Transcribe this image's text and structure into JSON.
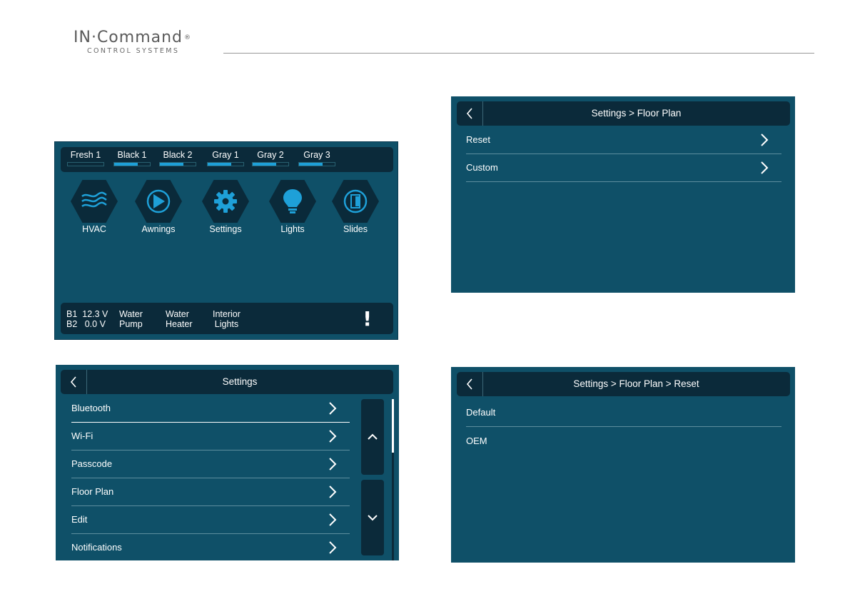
{
  "brand": {
    "name": "IN·Command",
    "registered": "®",
    "subtitle": "CONTROL SYSTEMS"
  },
  "colors": {
    "screen_bg": "#0f5068",
    "bar_bg": "#0b2a3a",
    "accent": "#1ea0d8",
    "page_bg": "#ffffff"
  },
  "home": {
    "tanks": [
      {
        "label": "Fresh 1",
        "level": 0
      },
      {
        "label": "Black 1",
        "level": 0.65
      },
      {
        "label": "Black 2",
        "level": 0.65
      },
      {
        "label": "Gray 1",
        "level": 0.65
      },
      {
        "label": "Gray 2",
        "level": 0.65
      },
      {
        "label": "Gray 3",
        "level": 0.65
      }
    ],
    "apps": [
      {
        "label": "HVAC",
        "icon": "hvac-waves-icon"
      },
      {
        "label": "Awnings",
        "icon": "awning-icon"
      },
      {
        "label": "Settings",
        "icon": "gear-icon"
      },
      {
        "label": "Lights",
        "icon": "lightbulb-icon"
      },
      {
        "label": "Slides",
        "icon": "slide-icon"
      }
    ],
    "battery": {
      "b1_label": "B1",
      "b1_value": "12.3 V",
      "b2_label": "B2",
      "b2_value": "0.0 V"
    },
    "toggles": [
      {
        "line1": "Water",
        "line2": "Pump"
      },
      {
        "line1": "Water",
        "line2": "Heater"
      },
      {
        "line1": "Interior",
        "line2": "Lights"
      }
    ],
    "alert": "!"
  },
  "settings": {
    "title": "Settings",
    "items": [
      {
        "label": "Bluetooth"
      },
      {
        "label": "Wi-Fi"
      },
      {
        "label": "Passcode"
      },
      {
        "label": "Floor Plan"
      },
      {
        "label": "Edit"
      },
      {
        "label": "Notifications"
      }
    ]
  },
  "floor_plan": {
    "title": "Settings > Floor Plan",
    "items": [
      {
        "label": "Reset"
      },
      {
        "label": "Custom"
      }
    ]
  },
  "reset": {
    "title": "Settings > Floor Plan > Reset",
    "items": [
      {
        "label": "Default"
      },
      {
        "label": "OEM"
      }
    ]
  }
}
